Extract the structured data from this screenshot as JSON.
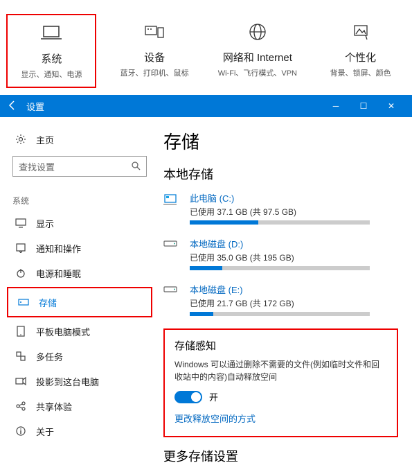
{
  "top": {
    "system": {
      "title": "系统",
      "sub": "显示、通知、电源"
    },
    "devices": {
      "title": "设备",
      "sub": "蓝牙、打印机、鼠标"
    },
    "network": {
      "title": "网络和 Internet",
      "sub": "Wi-Fi、飞行模式、VPN"
    },
    "personalization": {
      "title": "个性化",
      "sub": "背景、锁屏、颜色"
    }
  },
  "titlebar": {
    "title": "设置"
  },
  "sidebar": {
    "home": "主页",
    "search_placeholder": "查找设置",
    "group": "系统",
    "items": {
      "display": "显示",
      "notifications": "通知和操作",
      "power": "电源和睡眠",
      "storage": "存储",
      "tablet": "平板电脑模式",
      "multitask": "多任务",
      "project": "投影到这台电脑",
      "shared": "共享体验",
      "about": "关于"
    }
  },
  "content": {
    "title": "存储",
    "local_title": "本地存储",
    "drives": [
      {
        "name": "此电脑 (C:)",
        "usage": "已使用 37.1 GB (共 97.5 GB)",
        "percent": 38
      },
      {
        "name": "本地磁盘 (D:)",
        "usage": "已使用 35.0 GB (共 195 GB)",
        "percent": 18
      },
      {
        "name": "本地磁盘 (E:)",
        "usage": "已使用 21.7 GB (共 172 GB)",
        "percent": 13
      }
    ],
    "sense": {
      "title": "存储感知",
      "desc": "Windows 可以通过删除不需要的文件(例如临时文件和回收站中的内容)自动释放空间",
      "toggle_label": "开",
      "link": "更改释放空间的方式"
    },
    "more_title": "更多存储设置"
  }
}
